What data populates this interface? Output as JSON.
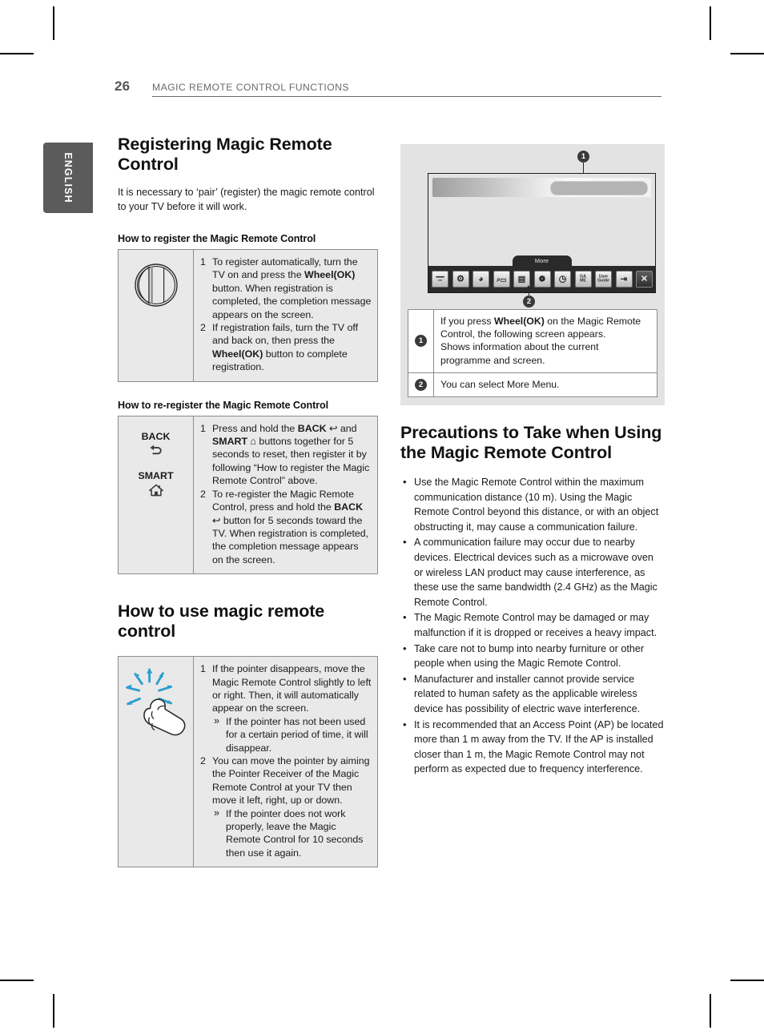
{
  "page": {
    "number": "26",
    "chapter": "MAGIC REMOTE CONTROL FUNCTIONS",
    "language_tab": "ENGLISH"
  },
  "left_column": {
    "section_title": "Registering Magic Remote Control",
    "intro": "It is necessary to ‘pair’ (register) the magic remote control to your TV before it will work.",
    "register": {
      "heading": "How to register the Magic Remote Control",
      "icon_name": "wheel-ok-icon",
      "steps": [
        {
          "num": "1",
          "parts": [
            {
              "t": "To register automatically, turn the TV on and press the ",
              "b": false
            },
            {
              "t": "Wheel(OK)",
              "b": true
            },
            {
              "t": " button. When registration is completed, the completion message appears on the screen.",
              "b": false
            }
          ]
        },
        {
          "num": "2",
          "parts": [
            {
              "t": "If registration fails, turn the TV off and back on, then press the ",
              "b": false
            },
            {
              "t": "Wheel(OK)",
              "b": true
            },
            {
              "t": " button to complete registration.",
              "b": false
            }
          ]
        }
      ]
    },
    "reregister": {
      "heading": "How to re-register the Magic Remote Control",
      "button_back_label": "BACK",
      "button_smart_label": "SMART",
      "steps": [
        {
          "num": "1",
          "parts": [
            {
              "t": "Press and hold the ",
              "b": false
            },
            {
              "t": "BACK",
              "b": true
            },
            {
              "t": " ↩ and ",
              "b": false
            },
            {
              "t": "SMART",
              "b": true
            },
            {
              "t": " ⌂ buttons together for 5 seconds to reset, then register it by following “How to register the Magic Remote Control” above.",
              "b": false
            }
          ]
        },
        {
          "num": "2",
          "parts": [
            {
              "t": "To re-register the Magic Remote Control, press and hold the ",
              "b": false
            },
            {
              "t": "BACK",
              "b": true
            },
            {
              "t": " ↩ button for 5 seconds toward the TV. When registration is completed, the completion message appears on the screen.",
              "b": false
            }
          ]
        }
      ]
    },
    "usage": {
      "section_title": "How to use magic remote control",
      "icon_name": "pointing-hand-icon",
      "steps": [
        {
          "num": "1",
          "text": "If the pointer disappears, move the Magic Remote Control slightly to left or right. Then, it will automatically appear on the screen.",
          "sub": [
            {
              "marker": "»",
              "text": "If the pointer has not been used for a certain period of time, it will disappear."
            }
          ]
        },
        {
          "num": "2",
          "text": "You can move the pointer by aiming the Pointer Receiver of the Magic Remote Control at your TV then move it left, right, up or down.",
          "sub": [
            {
              "marker": "»",
              "text": "If the pointer does not work properly, leave the Magic Remote Control for 10 seconds then use it again."
            }
          ]
        }
      ]
    }
  },
  "right_column": {
    "figure": {
      "more_tab_label": "More",
      "callout_1": "1",
      "callout_2": "2",
      "dock_icons": [
        {
          "name": "recording-list-icon",
          "glyph": "▭▭"
        },
        {
          "name": "settings-gear-icon",
          "glyph": "⚙"
        },
        {
          "name": "internet-globe-icon",
          "glyph": "◕"
        },
        {
          "name": "search-icon",
          "glyph": "🔍"
        },
        {
          "name": "tv-guide-icon",
          "glyph": "▤"
        },
        {
          "name": "3d-world-icon",
          "glyph": "❁"
        },
        {
          "name": "timer-clock-icon",
          "glyph": "◷"
        },
        {
          "name": "game-icon",
          "glyph": "GAME"
        },
        {
          "name": "user-guide-icon",
          "glyph": "User Guide"
        },
        {
          "name": "input-list-icon",
          "glyph": "⇥"
        },
        {
          "name": "exit-icon",
          "glyph": "✕"
        }
      ]
    },
    "legend": [
      {
        "key": "1",
        "parts": [
          {
            "t": "If you press ",
            "b": false
          },
          {
            "t": "Wheel(OK)",
            "b": true
          },
          {
            "t": " on the Magic Remote Control, the following screen appears.\nShows information about the current programme and screen.",
            "b": false
          }
        ]
      },
      {
        "key": "2",
        "parts": [
          {
            "t": "You can select More Menu.",
            "b": false
          }
        ]
      }
    ],
    "precautions": {
      "section_title": "Precautions to Take when Using the Magic Remote Control",
      "bullet_marker": "•",
      "bullets": [
        "Use the Magic Remote Control within the maximum communication distance (10 m). Using the Magic Remote Control beyond this distance, or with an object obstructing it, may cause a communication failure.",
        "A communication failure may occur due to nearby devices. Electrical devices such as a microwave oven or wireless LAN product may cause interference, as these use the same bandwidth (2.4 GHz) as the Magic Remote Control.",
        "The Magic Remote Control may be damaged or may malfunction if it is dropped or receives a heavy impact.",
        "Take care not to bump into nearby furniture or other people when using the Magic Remote Control.",
        "Manufacturer and installer cannot provide service related to human safety as the applicable wireless device has possibility of electric wave interference.",
        "It is recommended that an Access Point (AP) be located more than 1 m away from the TV. If the AP is installed closer than 1 m, the Magic Remote Control may not perform as expected due to frequency interference."
      ]
    }
  },
  "colors": {
    "panel_grey": "#e3e3e3",
    "table_grey": "#e9e9e9",
    "rule_grey": "#6a6a6a",
    "tab_grey": "#5b5b5b",
    "accent_blue": "#2a9fd0",
    "dock_black": "#2a2a2a"
  }
}
